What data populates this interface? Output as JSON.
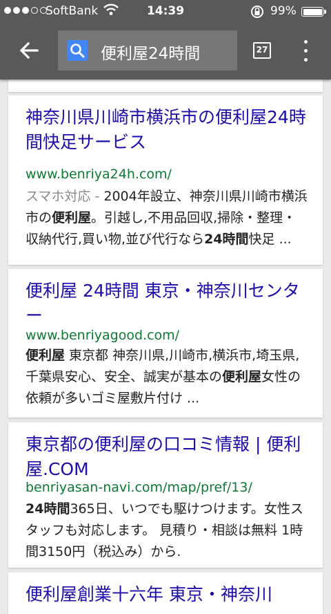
{
  "status": {
    "carrier": "SoftBank",
    "time": "14:39",
    "battery": "99%"
  },
  "toolbar": {
    "query": "便利屋24時間",
    "tab_count": "27"
  },
  "results": [
    {
      "title": "神奈川県川崎市横浜市の便利屋24時間快足サービス",
      "url": "www.benriya24h.com/",
      "label": "スマホ対応 - ",
      "snippet": [
        {
          "t": "2004年設立、神奈川県川崎市横浜市の"
        },
        {
          "t": "便利屋",
          "b": true
        },
        {
          "t": "。引越し,不用品回収,掃除・整理・収納代行,買い物,並び代行なら"
        },
        {
          "t": "24時間",
          "b": true
        },
        {
          "t": "快足 ..."
        }
      ]
    },
    {
      "title": "便利屋 24時間 東京・神奈川センター",
      "url": "www.benriyagood.com/",
      "snippet": [
        {
          "t": "便利屋",
          "b": true
        },
        {
          "t": " 東京都 神奈川県,川崎市,横浜市,埼玉県,千葉県安心、安全、誠実が基本の"
        },
        {
          "t": "便利屋",
          "b": true
        },
        {
          "t": "女性の依頼が多いゴミ屋敷片付け ..."
        }
      ]
    },
    {
      "title": "東京都の便利屋の口コミ情報 | 便利屋.COM",
      "url": "benriyasan-navi.com/map/pref/13/",
      "snippet": [
        {
          "t": "24時間",
          "b": true
        },
        {
          "t": "365日、いつでも駆けつけます。女性スタッフも対応します。 見積り・相談は無料 1時間3150円（税込み）から."
        }
      ]
    },
    {
      "title": "便利屋創業十六年 東京・神奈川"
    }
  ]
}
